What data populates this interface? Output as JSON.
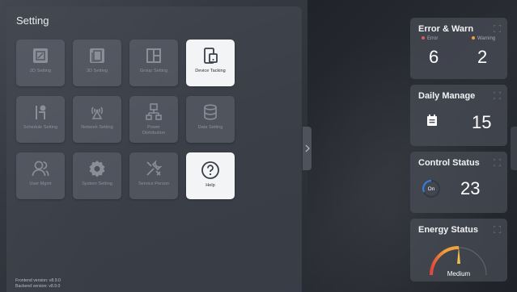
{
  "settings": {
    "title": "Setting",
    "tiles": [
      {
        "label": "2D Setting",
        "icon": "2d-setting-icon"
      },
      {
        "label": "3D Setting",
        "icon": "3d-setting-icon"
      },
      {
        "label": "Group Setting",
        "icon": "group-setting-icon"
      },
      {
        "label": "Device Tacking",
        "icon": "device-tracking-icon"
      },
      {
        "label": "Schedule Setting",
        "icon": "schedule-setting-icon"
      },
      {
        "label": "Network Setting",
        "icon": "network-setting-icon"
      },
      {
        "label": "Power\nDistribution",
        "icon": "power-distribution-icon"
      },
      {
        "label": "Data Setting",
        "icon": "data-setting-icon"
      },
      {
        "label": "User Mgmt",
        "icon": "user-icon"
      },
      {
        "label": "System Setting",
        "icon": "gear-icon"
      },
      {
        "label": "Service Person",
        "icon": "tools-icon"
      },
      {
        "label": "Help",
        "icon": "help-icon"
      }
    ],
    "frontend_version": "Frontend version: v8.9.0",
    "backend_version": "Backend version: v8.9.0"
  },
  "cards": {
    "error_warn": {
      "title": "Error & Warn",
      "error_label": "Error",
      "warning_label": "Warning",
      "error_count": "6",
      "warning_count": "2",
      "error_color": "#e05a5a",
      "warning_color": "#f0a23a"
    },
    "daily_manage": {
      "title": "Daily Manage",
      "count": "15"
    },
    "control_status": {
      "title": "Control Status",
      "on_label": "On",
      "count": "23",
      "accent": "#3a7bd5"
    },
    "energy_status": {
      "title": "Energy Status",
      "level_label": "Medium",
      "level": 0.5
    }
  }
}
